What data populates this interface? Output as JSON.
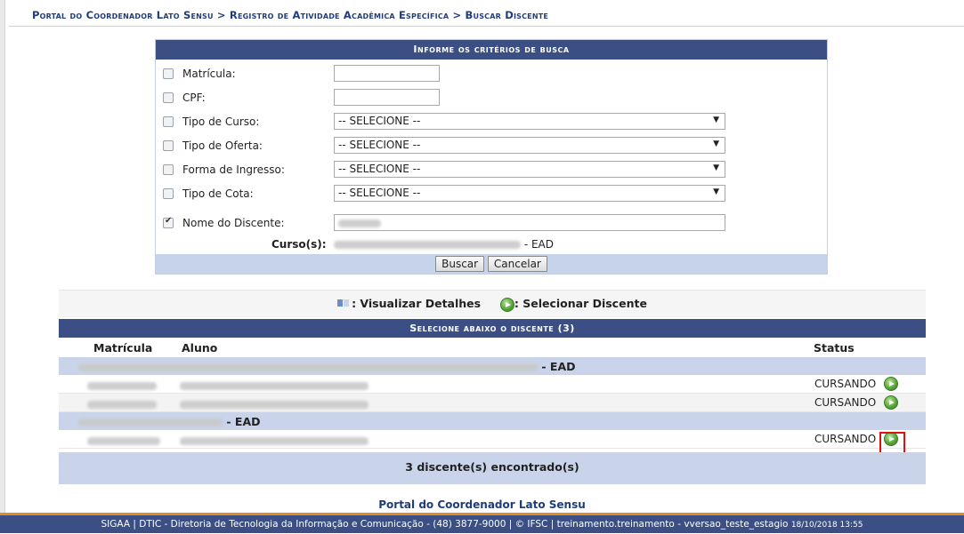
{
  "breadcrumb": {
    "items": [
      "Portal do Coordenador Lato Sensu",
      "Registro de Atividade Acadêmica Específica",
      "Buscar Discente"
    ],
    "separator": " > "
  },
  "search_form": {
    "title": "Informe os critérios de busca",
    "fields": {
      "matricula": {
        "label": "Matrícula:",
        "checked": false,
        "value": ""
      },
      "cpf": {
        "label": "CPF:",
        "checked": false,
        "value": ""
      },
      "tipo_curso": {
        "label": "Tipo de Curso:",
        "checked": false,
        "selected": "-- SELECIONE --"
      },
      "tipo_oferta": {
        "label": "Tipo de Oferta:",
        "checked": false,
        "selected": "-- SELECIONE --"
      },
      "forma_ingresso": {
        "label": "Forma de Ingresso:",
        "checked": false,
        "selected": "-- SELECIONE --"
      },
      "tipo_cota": {
        "label": "Tipo de Cota:",
        "checked": false,
        "selected": "-- SELECIONE --"
      },
      "nome_discente": {
        "label": "Nome do Discente:",
        "checked": true
      }
    },
    "cursos_label": "Curso(s):",
    "cursos_suffix": "- EAD",
    "buttons": {
      "buscar": "Buscar",
      "cancelar": "Cancelar"
    }
  },
  "legend": {
    "details": ": Visualizar Detalhes",
    "select": ": Selecionar Discente"
  },
  "results": {
    "title": "Selecione abaixo o discente (3)",
    "columns": {
      "matricula": "Matrícula",
      "aluno": "Aluno",
      "status": "Status"
    },
    "groups": [
      {
        "suffix": "- EAD",
        "rows": [
          {
            "status": "CURSANDO"
          },
          {
            "status": "CURSANDO"
          }
        ]
      },
      {
        "suffix": "- EAD",
        "rows": [
          {
            "status": "CURSANDO"
          }
        ]
      }
    ],
    "footer": "3 discente(s) encontrado(s)"
  },
  "portal_link": "Portal do Coordenador Lato Sensu",
  "footer": {
    "text": "SIGAA | DTIC - Diretoria de Tecnologia da Informação e Comunicação - (48) 3877-9000 | © IFSC | treinamento.treinamento - vversao_teste_estagio",
    "timestamp": "18/10/2018 13:55"
  },
  "colors": {
    "header_blue": "#3b4f85",
    "row_band": "#c9d4ea",
    "footer_accent": "#e08a2c"
  },
  "icons": [
    "details-icon",
    "select-arrow-icon"
  ]
}
